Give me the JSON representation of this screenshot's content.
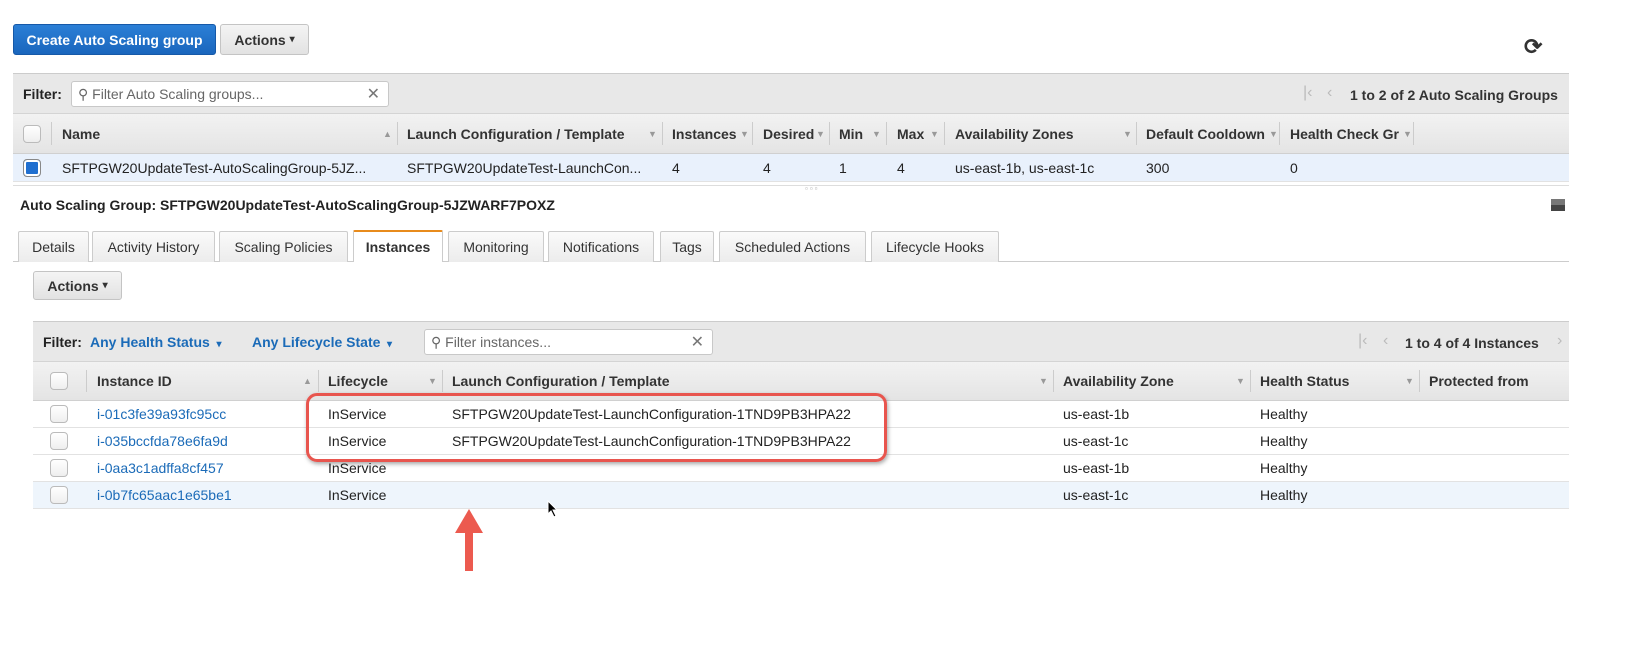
{
  "toolbar": {
    "create_label": "Create Auto Scaling group",
    "actions_label": "Actions",
    "refresh_icon": "refresh-icon"
  },
  "groups": {
    "filter_label": "Filter:",
    "filter_placeholder": "Filter Auto Scaling groups...",
    "pager": "1 to 2 of 2 Auto Scaling Groups",
    "columns": [
      "Name",
      "Launch Configuration / Template",
      "Instances",
      "Desired",
      "Min",
      "Max",
      "Availability Zones",
      "Default Cooldown",
      "Health Check Gr"
    ],
    "rows": [
      {
        "name": "SFTPGW20UpdateTest-AutoScalingGroup-5JZ...",
        "lc": "SFTPGW20UpdateTest-LaunchCon...",
        "instances": "4",
        "desired": "4",
        "min": "1",
        "max": "4",
        "az": "us-east-1b, us-east-1c",
        "cooldown": "300",
        "hc": "0",
        "selected": true
      }
    ]
  },
  "detail": {
    "title": "Auto Scaling Group: SFTPGW20UpdateTest-AutoScalingGroup-5JZWARF7POXZ",
    "tabs": [
      "Details",
      "Activity History",
      "Scaling Policies",
      "Instances",
      "Monitoring",
      "Notifications",
      "Tags",
      "Scheduled Actions",
      "Lifecycle Hooks"
    ],
    "active_tab": "Instances",
    "actions_label": "Actions",
    "filter_label": "Filter:",
    "health_filter": "Any Health Status",
    "lifecycle_filter": "Any Lifecycle State",
    "search_placeholder": "Filter instances...",
    "pager": "1 to 4 of 4 Instances",
    "columns": [
      "Instance ID",
      "Lifecycle",
      "Launch Configuration / Template",
      "Availability Zone",
      "Health Status",
      "Protected from"
    ],
    "rows": [
      {
        "id": "i-01c3fe39a93fc95cc",
        "lifecycle": "InService",
        "lc": "SFTPGW20UpdateTest-LaunchConfiguration-1TND9PB3HPA22",
        "az": "us-east-1b",
        "health": "Healthy"
      },
      {
        "id": "i-035bccfda78e6fa9d",
        "lifecycle": "InService",
        "lc": "SFTPGW20UpdateTest-LaunchConfiguration-1TND9PB3HPA22",
        "az": "us-east-1c",
        "health": "Healthy"
      },
      {
        "id": "i-0aa3c1adffa8cf457",
        "lifecycle": "InService",
        "lc": "",
        "az": "us-east-1b",
        "health": "Healthy"
      },
      {
        "id": "i-0b7fc65aac1e65be1",
        "lifecycle": "InService",
        "lc": "",
        "az": "us-east-1c",
        "health": "Healthy"
      }
    ]
  },
  "annotation_color": "#e8554e"
}
